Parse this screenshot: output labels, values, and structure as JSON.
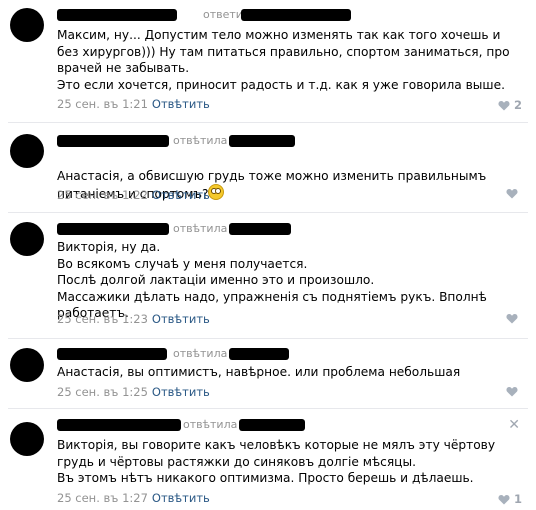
{
  "comments": [
    {
      "replied": "ответила",
      "text": "Максим, ну... Допустим тело можно изменять так как того хочешь и без хирургов))) Ну там питаться правильно, спортом заниматься, про врачей не забывать.\nЭто если хочется, приносит радость и т.д. как я уже говорила выше.",
      "date": "25 сен. въ 1:21",
      "reply": "Отвѣтить",
      "likes": "2"
    },
    {
      "replied": "отвѣтила",
      "text": "Анастасія, а обвисшую грудь тоже можно изменить правильнымъ питаніемъ и спортомъ?",
      "date": "25 сен. въ 1:22",
      "reply": "Отвѣтить",
      "likes": ""
    },
    {
      "replied": "отвѣтила",
      "text": "Викторія, ну да.\nВо всякомъ случаѣ у меня получается.\nПослѣ долгой лактаціи именно это и произошло.\nМассажики дѣлать надо, упражненія съ поднятіемъ рукъ. Вполнѣ работаетъ.",
      "date": "25 сен. въ 1:23",
      "reply": "Отвѣтить",
      "likes": ""
    },
    {
      "replied": "отвѣтила",
      "text": "Анастасія, вы оптимистъ, навѣрное. или проблема небольшая",
      "date": "25 сен. въ 1:25",
      "reply": "Отвѣтить",
      "likes": ""
    },
    {
      "replied": "отвѣтила",
      "text": "Викторія, вы говорите какъ человѣкъ которые не мялъ эту чёртову грудь и чёртовы растяжки до синяковъ долгіе мѣсяцы.\nВъ этомъ нѣтъ никакого оптимизма. Просто берешь и дѣлаешь.",
      "date": "25 сен. въ 1:27",
      "reply": "Отвѣтить",
      "likes": "1"
    }
  ],
  "colors": {
    "link": "#2a5885",
    "muted": "#939393",
    "like": "#9fa6b0"
  }
}
